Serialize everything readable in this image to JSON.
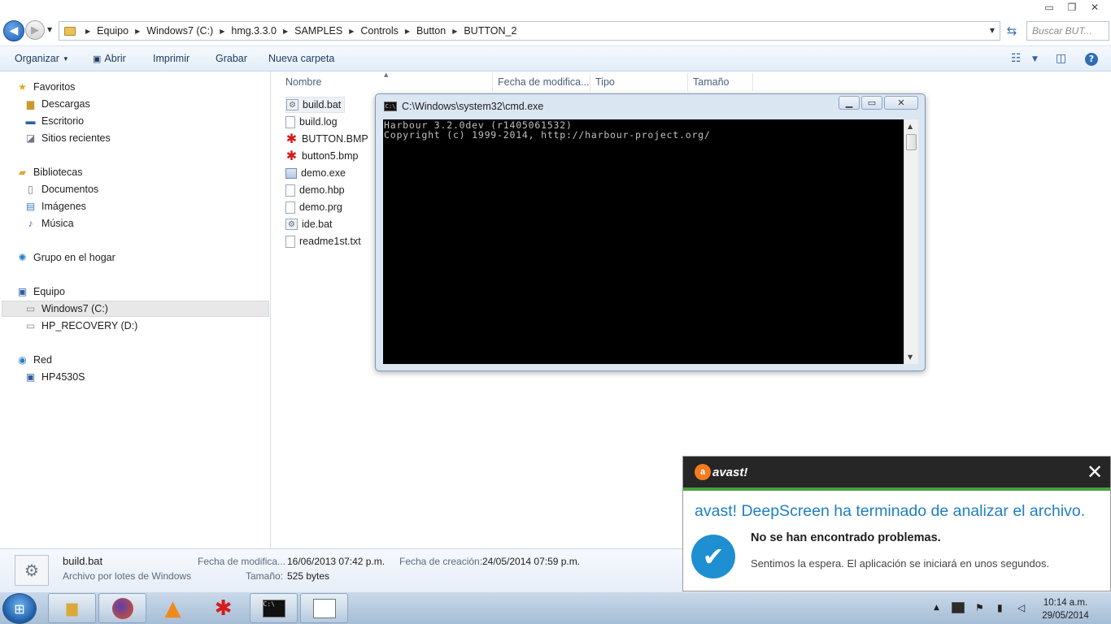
{
  "explorer": {
    "window_controls": {
      "minimize": "▭",
      "maximize": "❐",
      "close": "✕"
    },
    "breadcrumb": [
      "Equipo",
      "Windows7 (C:)",
      "hmg.3.3.0",
      "SAMPLES",
      "Controls",
      "Button",
      "BUTTON_2"
    ],
    "search_placeholder": "Buscar BUT...",
    "toolbar": {
      "organize": "Organizar",
      "open": "Abrir",
      "print": "Imprimir",
      "burn": "Grabar",
      "new_folder": "Nueva carpeta"
    },
    "nav": {
      "favorites": "Favoritos",
      "downloads": "Descargas",
      "desktop": "Escritorio",
      "recent": "Sitios recientes",
      "libraries": "Bibliotecas",
      "documents": "Documentos",
      "pictures": "Imágenes",
      "music": "Música",
      "homegroup": "Grupo en el hogar",
      "computer": "Equipo",
      "drive_c": "Windows7 (C:)",
      "drive_d": "HP_RECOVERY (D:)",
      "network": "Red",
      "network_pc": "HP4530S"
    },
    "columns": {
      "name": "Nombre",
      "date": "Fecha de modifica...",
      "type": "Tipo",
      "size": "Tamaño"
    },
    "files": [
      {
        "name": "build.bat",
        "kind": "bat"
      },
      {
        "name": "build.log",
        "kind": "doc"
      },
      {
        "name": "BUTTON.BMP",
        "kind": "bmp"
      },
      {
        "name": "button5.bmp",
        "kind": "bmp"
      },
      {
        "name": "demo.exe",
        "kind": "exe"
      },
      {
        "name": "demo.hbp",
        "kind": "doc"
      },
      {
        "name": "demo.prg",
        "kind": "doc"
      },
      {
        "name": "ide.bat",
        "kind": "bat"
      },
      {
        "name": "readme1st.txt",
        "kind": "doc"
      }
    ],
    "details": {
      "name": "build.bat",
      "type": "Archivo por lotes de Windows",
      "modified_label": "Fecha de modifica...",
      "modified_value": "16/06/2013 07:42 p.m.",
      "created_label": "Fecha de creación:",
      "created_value": "24/05/2014 07:59 p.m.",
      "size_label": "Tamaño:",
      "size_value": "525 bytes"
    }
  },
  "cmd": {
    "title": "C:\\Windows\\system32\\cmd.exe",
    "icon_text": "C:\\",
    "lines": [
      "Harbour 3.2.0dev (r1405061532)",
      "Copyright (c) 1999-2014, http://harbour-project.org/"
    ]
  },
  "avast": {
    "logo": "avast!",
    "title": "avast! DeepScreen ha terminado de analizar el archivo.",
    "bold": "No se han encontrado problemas.",
    "message": "Sentimos la espera. El aplicación se iniciará en unos segundos."
  },
  "taskbar": {
    "time": "10:14 a.m.",
    "date": "29/05/2014"
  },
  "colors": {
    "link_blue": "#1f7fc0",
    "avast_green": "#48a23d",
    "avast_orange": "#f47b20"
  }
}
